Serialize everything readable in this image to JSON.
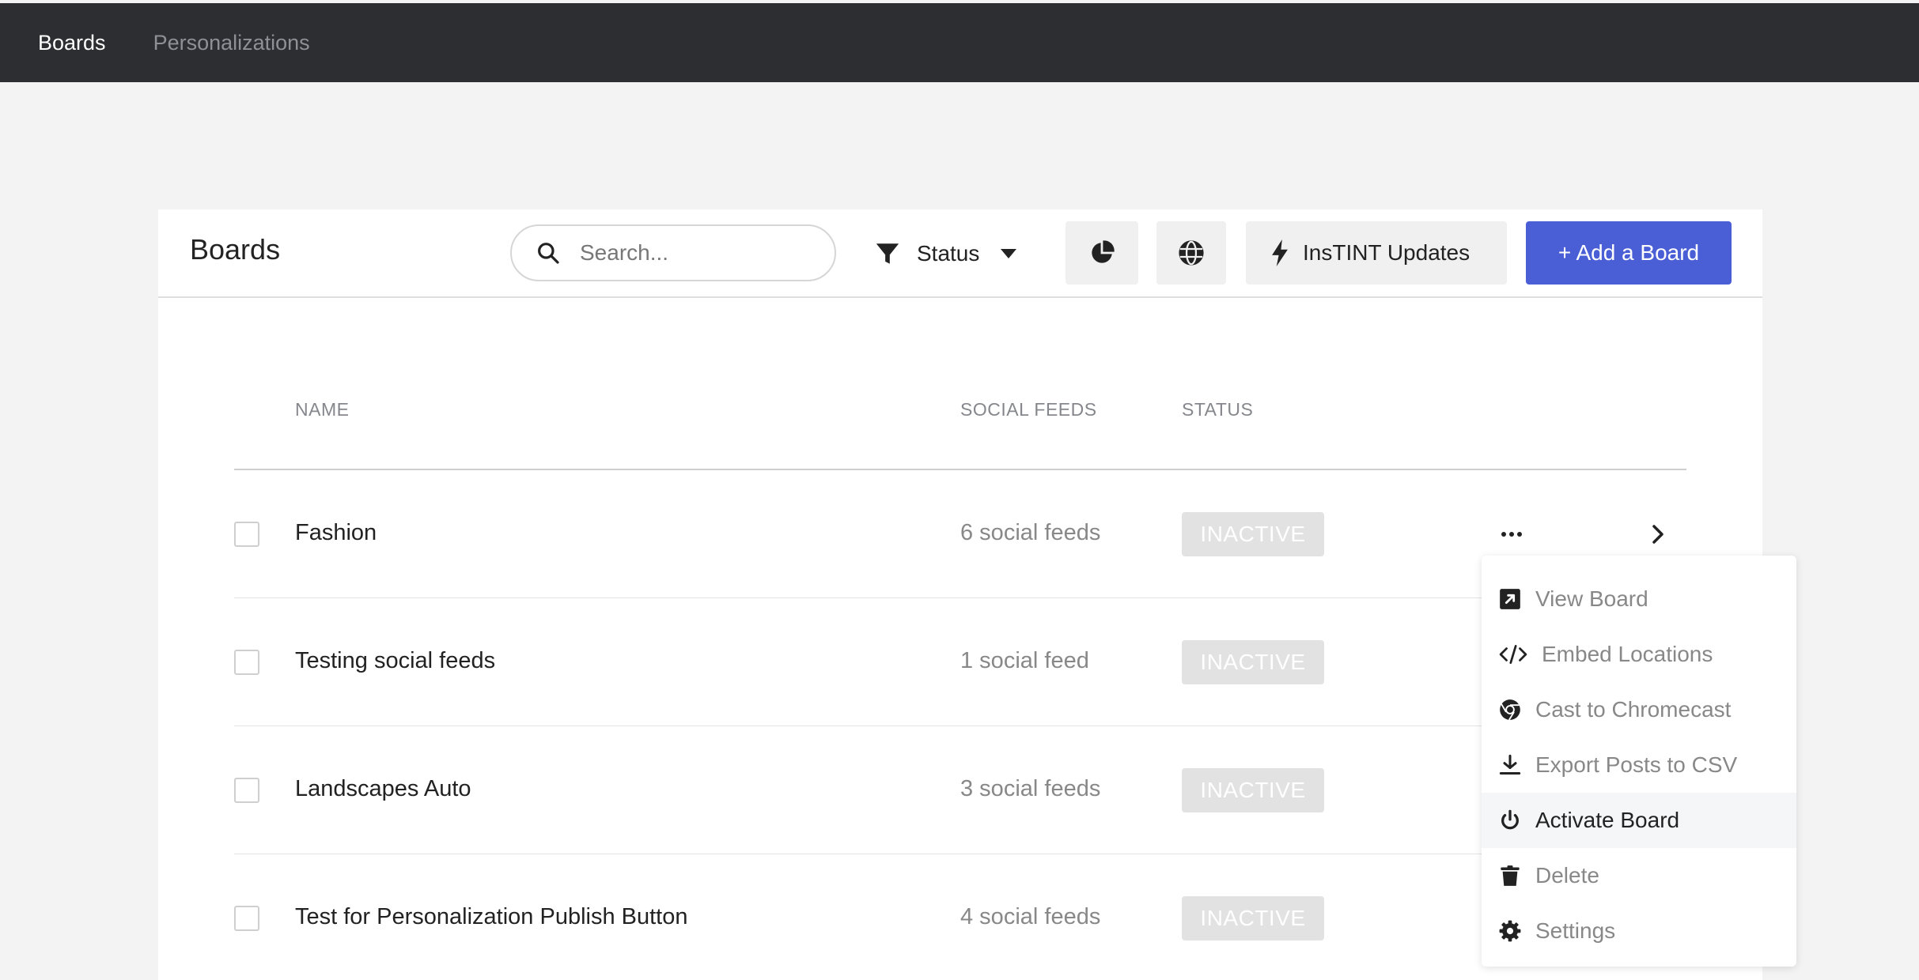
{
  "topnav": {
    "items": [
      {
        "label": "Boards",
        "active": true
      },
      {
        "label": "Personalizations",
        "active": false
      }
    ]
  },
  "header": {
    "title": "Boards",
    "search_placeholder": "Search...",
    "status_filter_label": "Status",
    "updates_label": "InsTINT Updates",
    "add_label": "+ Add a Board",
    "accent_color": "#4a5fd5"
  },
  "table": {
    "columns": [
      "NAME",
      "SOCIAL FEEDS",
      "STATUS"
    ],
    "rows": [
      {
        "name": "Fashion",
        "feeds": "6 social feeds",
        "status": "INACTIVE"
      },
      {
        "name": "Testing social feeds",
        "feeds": "1 social feed",
        "status": "INACTIVE"
      },
      {
        "name": "Landscapes Auto",
        "feeds": "3 social feeds",
        "status": "INACTIVE"
      },
      {
        "name": "Test for Personalization Publish Button",
        "feeds": "4 social feeds",
        "status": "INACTIVE"
      }
    ]
  },
  "menu": {
    "items": [
      {
        "label": "View Board",
        "icon": "external-link-icon"
      },
      {
        "label": "Embed Locations",
        "icon": "code-icon"
      },
      {
        "label": "Cast to Chromecast",
        "icon": "chrome-icon"
      },
      {
        "label": "Export Posts to CSV",
        "icon": "download-icon"
      },
      {
        "label": "Activate Board",
        "icon": "power-icon"
      },
      {
        "label": "Delete",
        "icon": "trash-icon"
      },
      {
        "label": "Settings",
        "icon": "gear-icon"
      }
    ]
  }
}
